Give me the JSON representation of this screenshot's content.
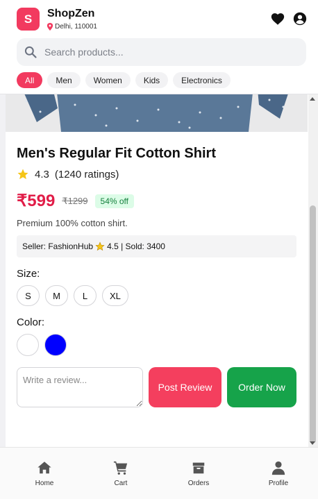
{
  "header": {
    "logo_letter": "S",
    "brand": "ShopZen",
    "location": "Delhi, 110001"
  },
  "search": {
    "placeholder": "Search products..."
  },
  "categories": [
    "All",
    "Men",
    "Women",
    "Kids",
    "Electronics"
  ],
  "active_category": "All",
  "product": {
    "title": "Men's Regular Fit Cotton Shirt",
    "rating": "4.3",
    "rating_count": "(1240 ratings)",
    "price": "₹599",
    "mrp": "₹1299",
    "discount": "54% off",
    "description": "Premium 100% cotton shirt.",
    "seller_prefix": "Seller: FashionHub",
    "seller_rating_sold": "4.5 | Sold: 3400"
  },
  "size_label": "Size:",
  "sizes": [
    "S",
    "M",
    "L",
    "XL"
  ],
  "color_label": "Color:",
  "colors": [
    "#ffffff",
    "#0000ff"
  ],
  "review": {
    "placeholder": "Write a review..."
  },
  "actions": {
    "post_review": "Post Review",
    "order_now": "Order Now"
  },
  "nav": [
    {
      "label": "Home",
      "icon": "home-icon"
    },
    {
      "label": "Cart",
      "icon": "cart-icon"
    },
    {
      "label": "Orders",
      "icon": "box-icon"
    },
    {
      "label": "Profile",
      "icon": "user-icon"
    }
  ],
  "theme": {
    "accent": "#f23a5f",
    "price": "#e11d48",
    "order_green": "#16a34a"
  }
}
